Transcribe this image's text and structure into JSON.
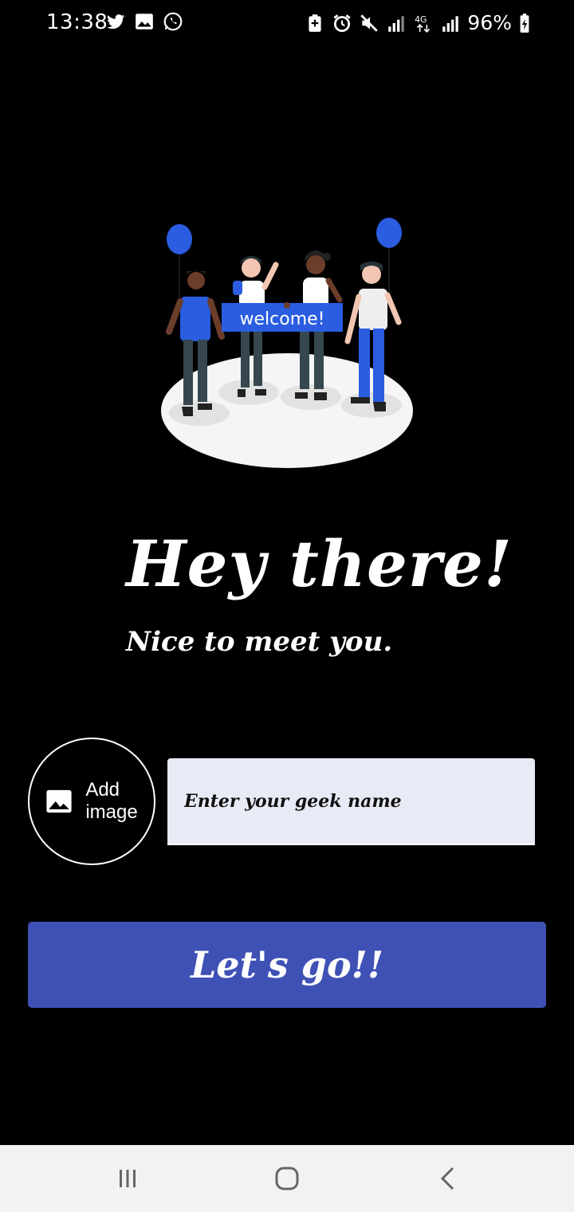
{
  "status_bar": {
    "time": "13:38",
    "battery": "96%",
    "left_icons": [
      "twitter-icon",
      "image-icon",
      "whatsapp-icon"
    ],
    "right_icons": [
      "battery-saver-icon",
      "alarm-icon",
      "mute-icon",
      "signal-icon",
      "4g-icon",
      "signal-icon"
    ]
  },
  "illustration": {
    "banner_text": "welcome!"
  },
  "header": {
    "title": "Hey there!",
    "subtitle": "Nice to meet you."
  },
  "form": {
    "add_image_label": "Add image",
    "name_placeholder": "Enter your geek name",
    "name_value": ""
  },
  "actions": {
    "go_label": "Let's go!!"
  },
  "colors": {
    "background": "#000000",
    "input_background": "#e8eaf6",
    "button": "#3f51b5",
    "balloon": "#2a5de0",
    "nav_bar": "#f2f2f2"
  }
}
